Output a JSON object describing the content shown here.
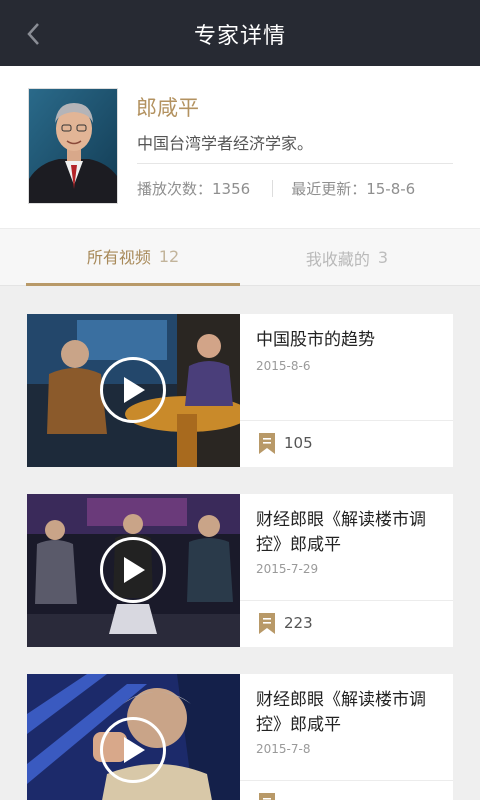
{
  "header": {
    "title": "专家详情",
    "back_icon": "chevron-left-icon"
  },
  "profile": {
    "name": "郎咸平",
    "description": "中国台湾学者经济学家。",
    "plays_label": "播放次数：",
    "plays_value": "1356",
    "updated_label": "最近更新：",
    "updated_value": "15-8-6"
  },
  "tabs": [
    {
      "label": "所有视频",
      "count": "12",
      "active": true
    },
    {
      "label": "我收藏的",
      "count": "3",
      "active": false
    }
  ],
  "videos": [
    {
      "title": "中国股市的趋势",
      "date": "2015-8-6",
      "count": "105"
    },
    {
      "title": "财经郎眼《解读楼市调控》郎咸平",
      "date": "2015-7-29",
      "count": "223"
    },
    {
      "title": "财经郎眼《解读楼市调控》郎咸平",
      "date": "2015-7-8",
      "count": ""
    }
  ],
  "colors": {
    "header_bg": "#272a33",
    "accent_gold": "#b39260",
    "page_bg": "#efefef"
  }
}
